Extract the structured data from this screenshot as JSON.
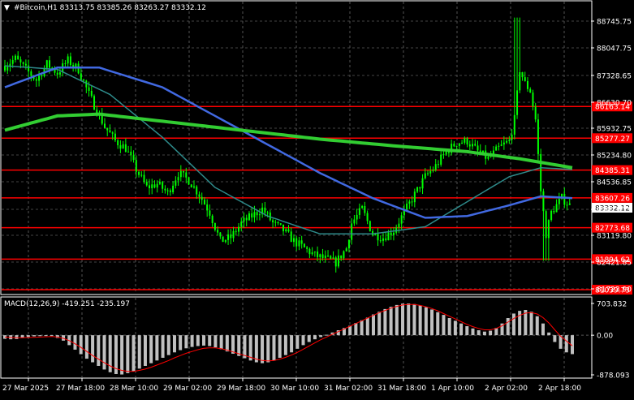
{
  "header": {
    "menu_glyph": "▼",
    "symbol_line": "#Bitcoin,H1  83313.75 83385.26 83263.27 83332.12"
  },
  "indicator": {
    "label": "MACD(12,26,9) -419.251 -235.197",
    "ticks": [
      "703.832",
      "0.00",
      "-878.093"
    ]
  },
  "price_axis": {
    "ticks": [
      "88745.75",
      "88047.75",
      "87328.65",
      "86630.70",
      "85932.75",
      "85234.80",
      "84536.85",
      "83817.75",
      "83119.80",
      "82421.85",
      "81723.90"
    ],
    "levels": [
      {
        "label": "86163.14",
        "price": 86163.14
      },
      {
        "label": "85277.27",
        "price": 85277.27
      },
      {
        "label": "84385.31",
        "price": 84385.31
      },
      {
        "label": "83607.26",
        "price": 83607.26
      },
      {
        "label": "82773.68",
        "price": 82773.68
      },
      {
        "label": "81894.62",
        "price": 81894.62
      },
      {
        "label": "81039.73",
        "price": 81039.73
      }
    ],
    "current": {
      "label": "83332.12",
      "price": 83332.12
    }
  },
  "time_axis": {
    "labels": [
      "27 Mar 2025",
      "27 Mar 18:00",
      "28 Mar 10:00",
      "29 Mar 02:00",
      "29 Mar 18:00",
      "30 Mar 10:00",
      "31 Mar 02:00",
      "31 Mar 18:00",
      "1 Apr 10:00",
      "2 Apr 02:00",
      "2 Apr 18:00"
    ]
  },
  "colors": {
    "background": "#000000",
    "candles": "#00ff00",
    "level_lines": "#ff0000",
    "ma_fast": "#4169e1",
    "ma_mid": "#2e8b8b",
    "ma_slow": "#32cd32",
    "macd_hist": "#c0c0c0",
    "macd_signal": "#ff0000"
  },
  "chart_data": {
    "type": "candlestick",
    "symbol": "#Bitcoin",
    "timeframe": "H1",
    "last_bar": {
      "open": 83313.75,
      "high": 83385.26,
      "low": 83263.27,
      "close": 83332.12
    },
    "close_path": [
      [
        0,
        87300
      ],
      [
        2,
        87500
      ],
      [
        4,
        87200
      ],
      [
        6,
        86900
      ],
      [
        8,
        87350
      ],
      [
        10,
        87100
      ],
      [
        12,
        87450
      ],
      [
        14,
        87200
      ],
      [
        16,
        86500
      ],
      [
        17,
        86200
      ],
      [
        19,
        85600
      ],
      [
        21,
        85200
      ],
      [
        23,
        85000
      ],
      [
        25,
        84400
      ],
      [
        27,
        83900
      ],
      [
        29,
        84000
      ],
      [
        31,
        83750
      ],
      [
        33,
        84300
      ],
      [
        35,
        84100
      ],
      [
        37,
        83700
      ],
      [
        39,
        83200
      ],
      [
        40,
        82800
      ],
      [
        41,
        82400
      ],
      [
        43,
        82500
      ],
      [
        45,
        82900
      ],
      [
        47,
        83100
      ],
      [
        49,
        83300
      ],
      [
        51,
        82900
      ],
      [
        53,
        82700
      ],
      [
        55,
        82400
      ],
      [
        57,
        82200
      ],
      [
        59,
        82000
      ],
      [
        61,
        81900
      ],
      [
        63,
        81800
      ],
      [
        65,
        82200
      ],
      [
        66,
        82900
      ],
      [
        68,
        83300
      ],
      [
        70,
        82600
      ],
      [
        72,
        82500
      ],
      [
        74,
        82700
      ],
      [
        76,
        83200
      ],
      [
        78,
        83700
      ],
      [
        80,
        84200
      ],
      [
        82,
        84500
      ],
      [
        84,
        84900
      ],
      [
        86,
        85150
      ],
      [
        88,
        85200
      ],
      [
        90,
        84900
      ],
      [
        92,
        84700
      ],
      [
        94,
        85000
      ],
      [
        96,
        85200
      ],
      [
        97,
        85800
      ],
      [
        98,
        87200
      ],
      [
        99,
        86800
      ],
      [
        100,
        86600
      ],
      [
        101,
        85800
      ],
      [
        102,
        83800
      ],
      [
        103,
        82600
      ],
      [
        104,
        83200
      ],
      [
        106,
        83600
      ],
      [
        108,
        83332
      ]
    ],
    "ma_fast_path": [
      [
        0,
        86700
      ],
      [
        10,
        87250
      ],
      [
        18,
        87250
      ],
      [
        30,
        86700
      ],
      [
        45,
        85500
      ],
      [
        60,
        84300
      ],
      [
        70,
        83600
      ],
      [
        80,
        83050
      ],
      [
        88,
        83100
      ],
      [
        96,
        83400
      ],
      [
        102,
        83650
      ],
      [
        108,
        83600
      ]
    ],
    "ma_mid_path": [
      [
        0,
        87300
      ],
      [
        10,
        87200
      ],
      [
        20,
        86500
      ],
      [
        30,
        85300
      ],
      [
        40,
        83900
      ],
      [
        50,
        83100
      ],
      [
        60,
        82600
      ],
      [
        70,
        82600
      ],
      [
        80,
        82800
      ],
      [
        88,
        83500
      ],
      [
        96,
        84200
      ],
      [
        102,
        84450
      ],
      [
        108,
        84400
      ]
    ],
    "ma_slow_path": [
      [
        0,
        85500
      ],
      [
        10,
        85900
      ],
      [
        18,
        85950
      ],
      [
        30,
        85750
      ],
      [
        45,
        85500
      ],
      [
        60,
        85250
      ],
      [
        75,
        85050
      ],
      [
        88,
        84900
      ],
      [
        98,
        84700
      ],
      [
        108,
        84450
      ]
    ],
    "price_range": [
      80950,
      89050
    ],
    "macd_hist": [
      -80,
      -90,
      -85,
      -60,
      -40,
      -25,
      -20,
      -15,
      -10,
      -60,
      -120,
      -220,
      -320,
      -420,
      -520,
      -600,
      -680,
      -760,
      -820,
      -860,
      -870,
      -840,
      -800,
      -740,
      -680,
      -620,
      -560,
      -500,
      -440,
      -380,
      -330,
      -290,
      -260,
      -240,
      -230,
      -240,
      -270,
      -310,
      -360,
      -410,
      -460,
      -510,
      -560,
      -600,
      -620,
      -600,
      -560,
      -500,
      -440,
      -380,
      -300,
      -220,
      -150,
      -90,
      -40,
      10,
      60,
      110,
      160,
      210,
      270,
      330,
      390,
      460,
      520,
      580,
      630,
      670,
      700,
      703,
      690,
      660,
      620,
      570,
      510,
      450,
      380,
      320,
      260,
      200,
      150,
      110,
      80,
      100,
      160,
      260,
      380,
      480,
      540,
      560,
      520,
      420,
      260,
      60,
      -150,
      -300,
      -380,
      -419
    ],
    "macd_signal": [
      -40,
      -50,
      -55,
      -55,
      -50,
      -45,
      -40,
      -35,
      -30,
      -40,
      -70,
      -120,
      -190,
      -270,
      -360,
      -450,
      -530,
      -610,
      -680,
      -740,
      -780,
      -800,
      -800,
      -780,
      -750,
      -710,
      -660,
      -610,
      -560,
      -500,
      -450,
      -400,
      -360,
      -320,
      -290,
      -280,
      -280,
      -300,
      -330,
      -370,
      -410,
      -450,
      -490,
      -530,
      -560,
      -570,
      -560,
      -530,
      -490,
      -440,
      -380,
      -310,
      -240,
      -170,
      -100,
      -40,
      20,
      80,
      140,
      200,
      260,
      320,
      380,
      440,
      500,
      550,
      600,
      640,
      670,
      680,
      680,
      660,
      630,
      590,
      540,
      480,
      420,
      360,
      300,
      240,
      190,
      150,
      120,
      120,
      150,
      210,
      290,
      370,
      440,
      490,
      500,
      470,
      390,
      270,
      120,
      -20,
      -130,
      -235
    ],
    "macd_range": [
      -878.093,
      703.832
    ]
  }
}
